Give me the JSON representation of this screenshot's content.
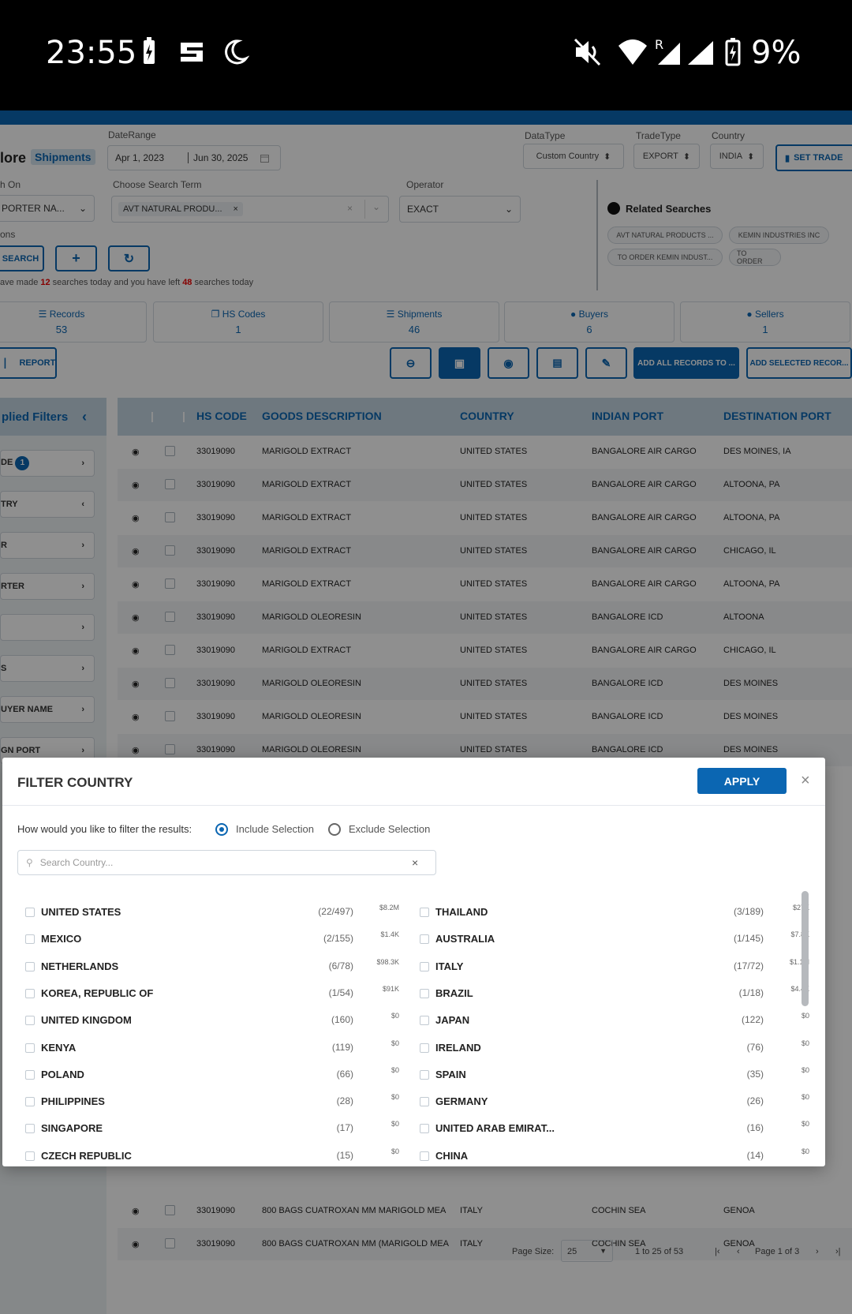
{
  "status": {
    "time": "23:55",
    "battery": "9%"
  },
  "header": {
    "explore": "lore",
    "shipments": "Shipments",
    "date_range_label": "DateRange",
    "date_from": "Apr 1, 2023",
    "date_to": "Jun 30, 2025",
    "datatype_label": "DataType",
    "datatype_value": "Custom Country",
    "tradetype_label": "TradeType",
    "tradetype_value": "EXPORT",
    "country_label": "Country",
    "country_value": "INDIA",
    "set_trade": "SET TRADE"
  },
  "search": {
    "search_on_label": "h On",
    "search_on_value": "PORTER NA...",
    "term_label": "Choose Search Term",
    "term_value": "AVT NATURAL PRODU...",
    "operator_label": "Operator",
    "operator_value": "EXACT",
    "options_label": "ons",
    "search_btn": "SEARCH",
    "quota_prefix": "ave made ",
    "quota_made": "12",
    "quota_mid": " searches today and you have left ",
    "quota_left": "48",
    "quota_suffix": " searches today"
  },
  "related": {
    "title": "Related Searches",
    "chips": [
      "AVT NATURAL PRODUCTS ...",
      "KEMIN INDUSTRIES INC",
      "TO ORDER KEMIN INDUST...",
      "TO ORDER"
    ]
  },
  "stats": [
    {
      "label": "Records",
      "value": "53"
    },
    {
      "label": "HS Codes",
      "value": "1"
    },
    {
      "label": "Shipments",
      "value": "46"
    },
    {
      "label": "Buyers",
      "value": "6"
    },
    {
      "label": "Sellers",
      "value": "1"
    }
  ],
  "actions": {
    "report": "REPORT",
    "add_all": "ADD ALL RECORDS TO ...",
    "add_selected": "ADD SELECTED RECOR..."
  },
  "sidebar": {
    "title": "plied Filters",
    "items": [
      {
        "label": "DE",
        "badge": "1"
      },
      {
        "label": "TRY"
      },
      {
        "label": "R"
      },
      {
        "label": "RTER"
      },
      {
        "label": ""
      },
      {
        "label": "S"
      },
      {
        "label": "UYER NAME"
      },
      {
        "label": "GN PORT"
      }
    ]
  },
  "table": {
    "headers": [
      "HS CODE",
      "GOODS DESCRIPTION",
      "COUNTRY",
      "INDIAN PORT",
      "DESTINATION PORT"
    ],
    "rows": [
      [
        "33019090",
        "MARIGOLD EXTRACT",
        "UNITED STATES",
        "BANGALORE AIR CARGO",
        "DES MOINES, IA"
      ],
      [
        "33019090",
        "MARIGOLD EXTRACT",
        "UNITED STATES",
        "BANGALORE AIR CARGO",
        "ALTOONA, PA"
      ],
      [
        "33019090",
        "MARIGOLD EXTRACT",
        "UNITED STATES",
        "BANGALORE AIR CARGO",
        "ALTOONA, PA"
      ],
      [
        "33019090",
        "MARIGOLD EXTRACT",
        "UNITED STATES",
        "BANGALORE AIR CARGO",
        "CHICAGO, IL"
      ],
      [
        "33019090",
        "MARIGOLD EXTRACT",
        "UNITED STATES",
        "BANGALORE AIR CARGO",
        "ALTOONA, PA"
      ],
      [
        "33019090",
        "MARIGOLD OLEORESIN",
        "UNITED STATES",
        "BANGALORE ICD",
        "ALTOONA"
      ],
      [
        "33019090",
        "MARIGOLD EXTRACT",
        "UNITED STATES",
        "BANGALORE AIR CARGO",
        "CHICAGO, IL"
      ],
      [
        "33019090",
        "MARIGOLD OLEORESIN",
        "UNITED STATES",
        "BANGALORE ICD",
        "DES MOINES"
      ],
      [
        "33019090",
        "MARIGOLD OLEORESIN",
        "UNITED STATES",
        "BANGALORE ICD",
        "DES MOINES"
      ],
      [
        "33019090",
        "MARIGOLD OLEORESIN",
        "UNITED STATES",
        "BANGALORE ICD",
        "DES MOINES"
      ],
      [
        "33019090",
        "800 BAGS CUATROXAN MM MARIGOLD MEA",
        "ITALY",
        "COCHIN SEA",
        "GENOA"
      ],
      [
        "33019090",
        "800 BAGS CUATROXAN MM (MARIGOLD MEA",
        "ITALY",
        "COCHIN SEA",
        "GENOA"
      ]
    ]
  },
  "pager": {
    "page_size_label": "Page Size:",
    "page_size": "25",
    "range": "1 to 25 of 53",
    "page": "Page 1 of 3"
  },
  "modal": {
    "title": "FILTER COUNTRY",
    "apply": "APPLY",
    "question": "How would you like to filter the results:",
    "include": "Include Selection",
    "exclude": "Exclude Selection",
    "search_placeholder": "Search Country...",
    "left": [
      {
        "name": "UNITED STATES",
        "count": "(22/497)",
        "value": "$8.2M"
      },
      {
        "name": "MEXICO",
        "count": "(2/155)",
        "value": "$1.4K"
      },
      {
        "name": "NETHERLANDS",
        "count": "(6/78)",
        "value": "$98.3K"
      },
      {
        "name": "KOREA, REPUBLIC OF",
        "count": "(1/54)",
        "value": "$91K"
      },
      {
        "name": "UNITED KINGDOM",
        "count": "(160)",
        "value": "$0"
      },
      {
        "name": "KENYA",
        "count": "(119)",
        "value": "$0"
      },
      {
        "name": "POLAND",
        "count": "(66)",
        "value": "$0"
      },
      {
        "name": "PHILIPPINES",
        "count": "(28)",
        "value": "$0"
      },
      {
        "name": "SINGAPORE",
        "count": "(17)",
        "value": "$0"
      },
      {
        "name": "CZECH REPUBLIC",
        "count": "(15)",
        "value": "$0"
      }
    ],
    "right": [
      {
        "name": "THAILAND",
        "count": "(3/189)",
        "value": "$27K"
      },
      {
        "name": "AUSTRALIA",
        "count": "(1/145)",
        "value": "$7.8K"
      },
      {
        "name": "ITALY",
        "count": "(17/72)",
        "value": "$1.1M"
      },
      {
        "name": "BRAZIL",
        "count": "(1/18)",
        "value": "$4.4K"
      },
      {
        "name": "JAPAN",
        "count": "(122)",
        "value": "$0"
      },
      {
        "name": "IRELAND",
        "count": "(76)",
        "value": "$0"
      },
      {
        "name": "SPAIN",
        "count": "(35)",
        "value": "$0"
      },
      {
        "name": "GERMANY",
        "count": "(26)",
        "value": "$0"
      },
      {
        "name": "UNITED ARAB EMIRAT...",
        "count": "(16)",
        "value": "$0"
      },
      {
        "name": "CHINA",
        "count": "(14)",
        "value": "$0"
      }
    ]
  }
}
